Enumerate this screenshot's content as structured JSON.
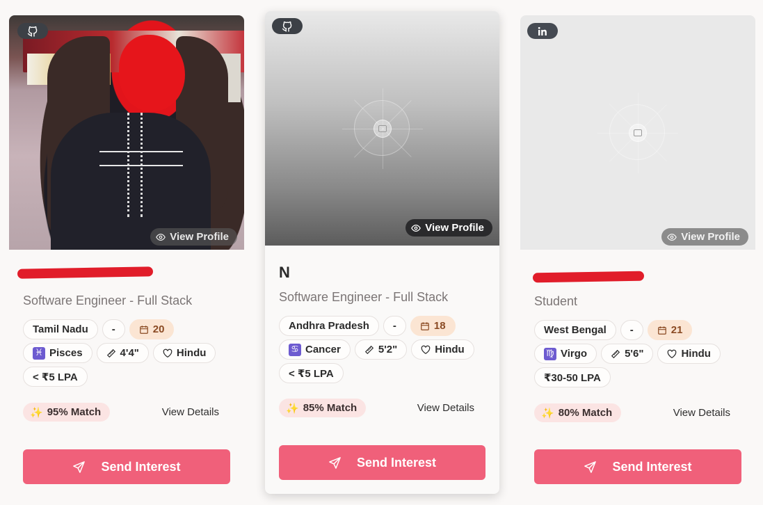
{
  "cards": [
    {
      "source_icon": "github-icon",
      "view_profile": "View Profile",
      "name": "",
      "role": "Software Engineer - Full Stack",
      "location": "Tamil Nadu",
      "dash": "-",
      "age": "20",
      "zodiac_symbol": "♓",
      "zodiac": "Pisces",
      "height": "4'4\"",
      "religion": "Hindu",
      "income": "< ₹5 LPA",
      "match": "95% Match",
      "view_details": "View Details",
      "send_interest": "Send Interest"
    },
    {
      "source_icon": "github-icon",
      "view_profile": "View Profile",
      "name": "N",
      "role": "Software Engineer - Full Stack",
      "location": "Andhra Pradesh",
      "dash": "-",
      "age": "18",
      "zodiac_symbol": "♋",
      "zodiac": "Cancer",
      "height": "5'2\"",
      "religion": "Hindu",
      "income": "< ₹5 LPA",
      "match": "85% Match",
      "view_details": "View Details",
      "send_interest": "Send Interest"
    },
    {
      "source_icon": "linkedin-icon",
      "view_profile": "View Profile",
      "name": "",
      "role": "Student",
      "location": "West Bengal",
      "dash": "-",
      "age": "21",
      "zodiac_symbol": "♍",
      "zodiac": "Virgo",
      "height": "5'6\"",
      "religion": "Hindu",
      "income": "₹30-50 LPA",
      "match": "80% Match",
      "view_details": "View Details",
      "send_interest": "Send Interest"
    }
  ],
  "colors": {
    "accent": "#f0607a",
    "age_badge_bg": "#fbe5d3",
    "match_badge_bg": "#fbe4e3",
    "source_badge_bg": "#3c4046"
  }
}
